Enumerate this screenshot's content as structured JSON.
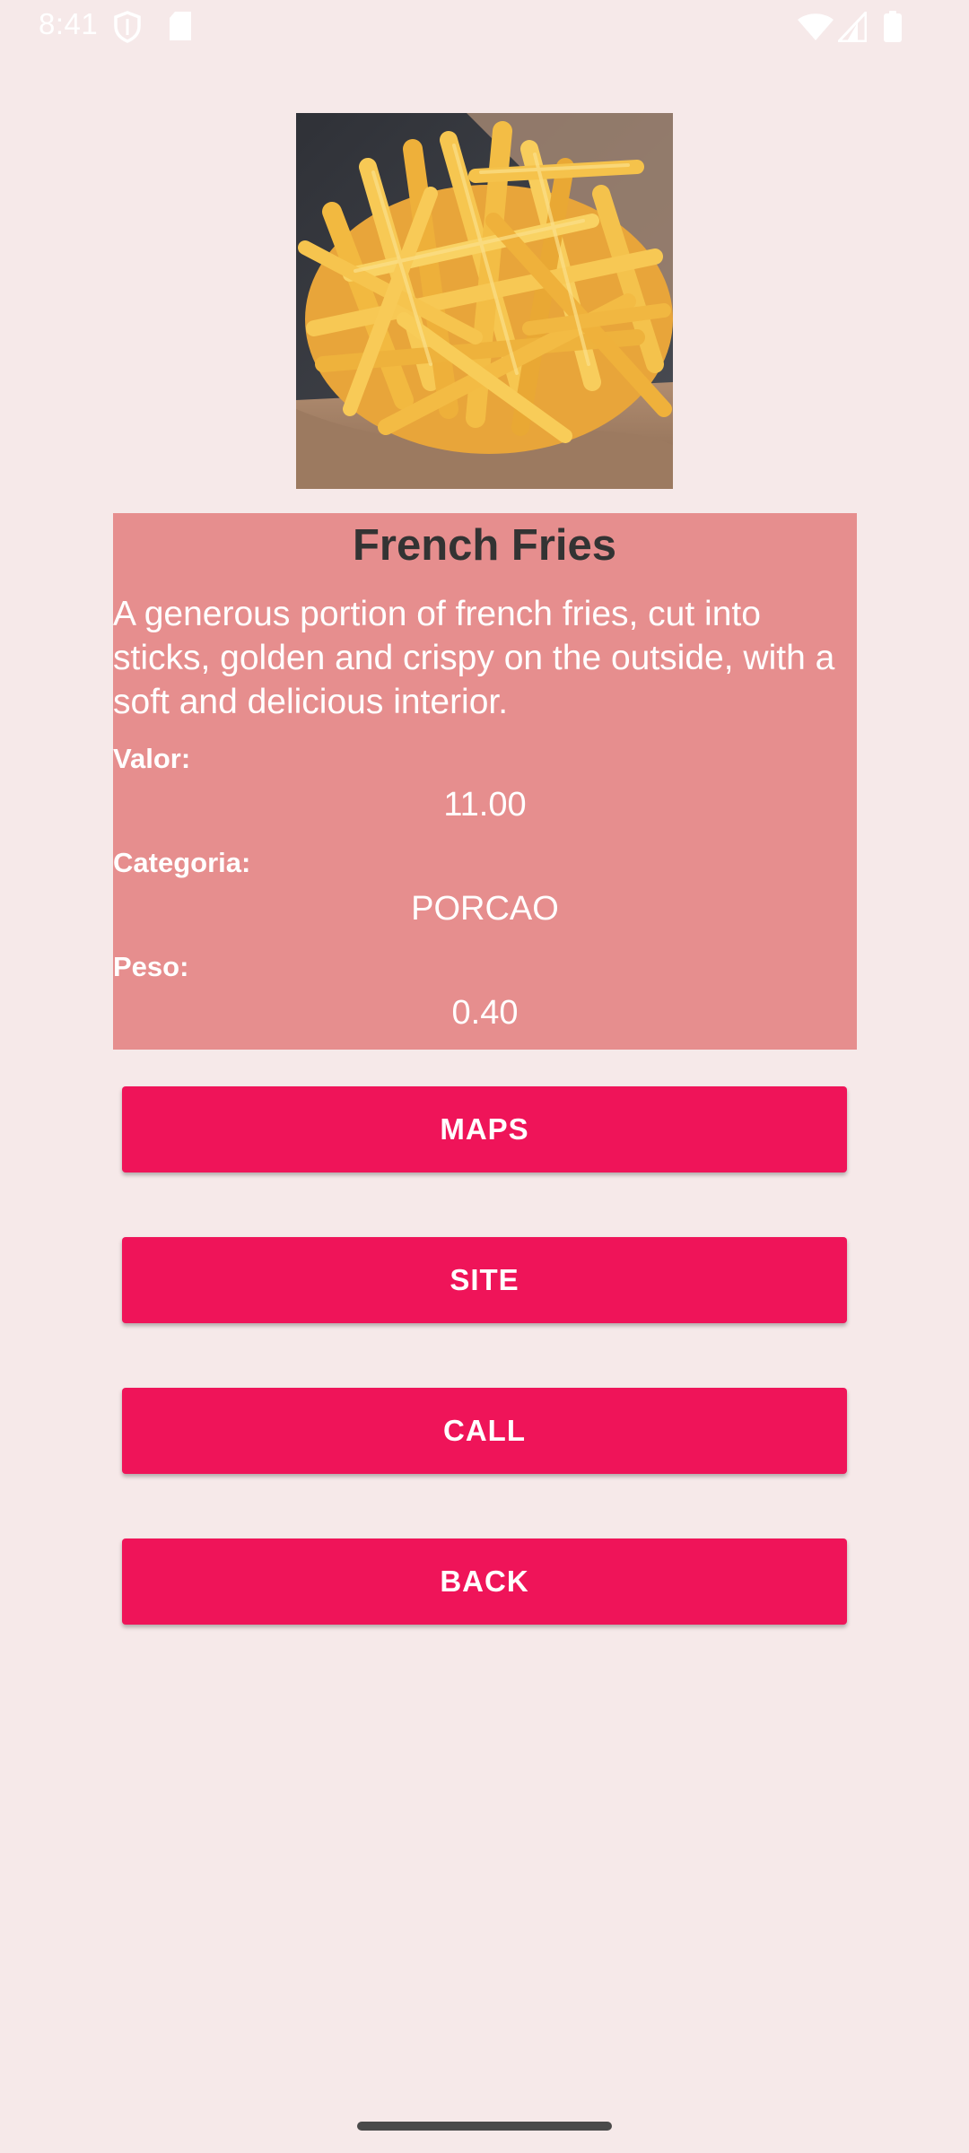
{
  "status_bar": {
    "time": "8:41",
    "icons": [
      "shield-icon",
      "sd-card-icon",
      "wifi-icon",
      "signal-icon",
      "battery-icon"
    ]
  },
  "product": {
    "image_subject": "french-fries-photo",
    "title": "French Fries",
    "description": "A generous portion of french fries, cut into sticks, golden and crispy on the outside, with a soft and delicious interior.",
    "fields": [
      {
        "label": "Valor:",
        "value": "11.00"
      },
      {
        "label": "Categoria:",
        "value": "PORCAO"
      },
      {
        "label": "Peso:",
        "value": "0.40"
      }
    ]
  },
  "buttons": {
    "maps": "MAPS",
    "site": "SITE",
    "call": "CALL",
    "back": "BACK"
  },
  "colors": {
    "background": "#f6e9e9",
    "panel": "#e68e8e",
    "accent": "#ef1459",
    "title_text": "#333333"
  }
}
